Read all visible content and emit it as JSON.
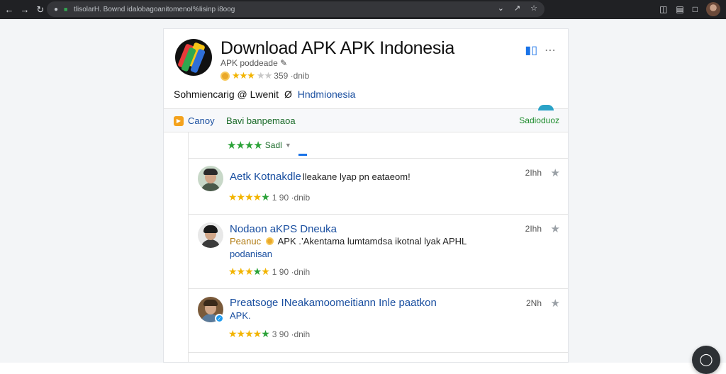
{
  "browser": {
    "url": "tlisolarH. Bownd idalobagoanitomenoI%Iisinp i8oog",
    "icons": {
      "back": "arrow-left-icon",
      "forward": "arrow-right-icon",
      "reload": "reload-icon",
      "lock": "lock-icon",
      "star": "star-icon"
    }
  },
  "app": {
    "title": "Download APK APK Indonesia",
    "subtitle": "APK poddeade",
    "rating_count": "359 ·dnib"
  },
  "about": {
    "lead": "Sohmiencarig @ Lwenit",
    "mark": "Ø",
    "location": "Hndmionesia"
  },
  "filterbar": {
    "left_label": "Canoy",
    "center_label": "Bavi banpemaoa",
    "right_label": "Sadioduoz"
  },
  "rating_filter": {
    "label": "Sadl"
  },
  "reviews": [
    {
      "name": "Aetk Kotnakdle",
      "extra": "lleakane lyap pn eataeom!",
      "time": "2Ihh",
      "stars_text": "1 90 ·dnib"
    },
    {
      "name": "Nodaon aKPS Dneuka",
      "prefix": "Peanuc",
      "text": "APK .’Akentama lumtamdsa ikotnal lyak APHL",
      "line3": "podanisan",
      "time": "2Ihh",
      "stars_text": "1 90 ·dnih"
    },
    {
      "name": "Preatsoge INeakamoomeitiann Inle paatkon",
      "line3": "APK.",
      "time": "2Nh",
      "stars_text": "3 90 ·dnih"
    }
  ],
  "colors": {
    "accent_blue": "#1a4fa0",
    "green": "#2ba238",
    "gold": "#f2b400",
    "chrome": "#202124"
  }
}
